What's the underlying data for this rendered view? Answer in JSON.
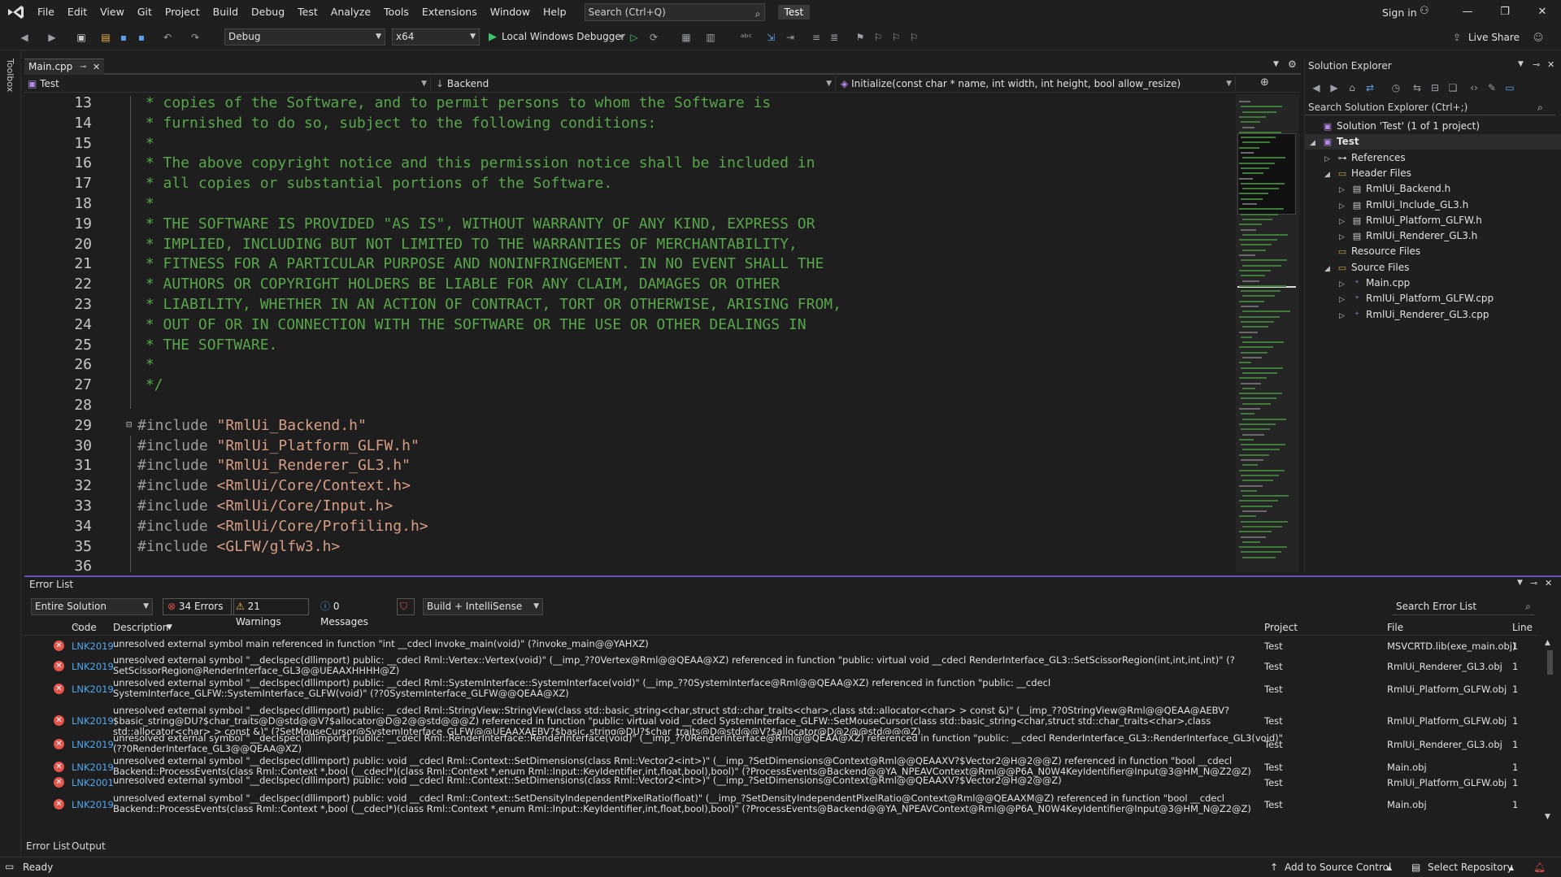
{
  "menubar": {
    "items": [
      "File",
      "Edit",
      "View",
      "Git",
      "Project",
      "Build",
      "Debug",
      "Test",
      "Analyze",
      "Tools",
      "Extensions",
      "Window",
      "Help"
    ],
    "search_placeholder": "Search (Ctrl+Q)",
    "project_badge": "Test",
    "sign_in": "Sign in"
  },
  "toolbar": {
    "config": "Debug",
    "platform": "x64",
    "debugger": "Local Windows Debugger",
    "live_share": "Live Share"
  },
  "toolbox_label": "Toolbox",
  "editor": {
    "tab_label": "Main.cpp",
    "nav_project": "Test",
    "nav_scope": "Backend",
    "nav_member": "Initialize(const char * name, int width, int height, bool allow_resize)",
    "lines": [
      {
        "n": "13",
        "type": "cmt",
        "text": " * copies of the Software, and to permit persons to whom the Software is"
      },
      {
        "n": "14",
        "type": "cmt",
        "text": " * furnished to do so, subject to the following conditions:"
      },
      {
        "n": "15",
        "type": "cmt",
        "text": " *"
      },
      {
        "n": "16",
        "type": "cmt",
        "text": " * The above copyright notice and this permission notice shall be included in"
      },
      {
        "n": "17",
        "type": "cmt",
        "text": " * all copies or substantial portions of the Software."
      },
      {
        "n": "18",
        "type": "cmt",
        "text": " *"
      },
      {
        "n": "19",
        "type": "cmt",
        "text": " * THE SOFTWARE IS PROVIDED \"AS IS\", WITHOUT WARRANTY OF ANY KIND, EXPRESS OR"
      },
      {
        "n": "20",
        "type": "cmt",
        "text": " * IMPLIED, INCLUDING BUT NOT LIMITED TO THE WARRANTIES OF MERCHANTABILITY,"
      },
      {
        "n": "21",
        "type": "cmt",
        "text": " * FITNESS FOR A PARTICULAR PURPOSE AND NONINFRINGEMENT. IN NO EVENT SHALL THE"
      },
      {
        "n": "22",
        "type": "cmt",
        "text": " * AUTHORS OR COPYRIGHT HOLDERS BE LIABLE FOR ANY CLAIM, DAMAGES OR OTHER"
      },
      {
        "n": "23",
        "type": "cmt",
        "text": " * LIABILITY, WHETHER IN AN ACTION OF CONTRACT, TORT OR OTHERWISE, ARISING FROM,"
      },
      {
        "n": "24",
        "type": "cmt",
        "text": " * OUT OF OR IN CONNECTION WITH THE SOFTWARE OR THE USE OR OTHER DEALINGS IN"
      },
      {
        "n": "25",
        "type": "cmt",
        "text": " * THE SOFTWARE."
      },
      {
        "n": "26",
        "type": "cmt",
        "text": " *"
      },
      {
        "n": "27",
        "type": "cmt",
        "text": " */"
      },
      {
        "n": "28",
        "type": "blank",
        "text": ""
      },
      {
        "n": "29",
        "type": "inc",
        "kw": "#include ",
        "text": "\"RmlUi_Backend.h\""
      },
      {
        "n": "30",
        "type": "inc",
        "kw": "#include ",
        "text": "\"RmlUi_Platform_GLFW.h\""
      },
      {
        "n": "31",
        "type": "inc",
        "kw": "#include ",
        "text": "\"RmlUi_Renderer_GL3.h\""
      },
      {
        "n": "32",
        "type": "inc",
        "kw": "#include ",
        "text": "<RmlUi/Core/Context.h>"
      },
      {
        "n": "33",
        "type": "inc",
        "kw": "#include ",
        "text": "<RmlUi/Core/Input.h>"
      },
      {
        "n": "34",
        "type": "inc",
        "kw": "#include ",
        "text": "<RmlUi/Core/Profiling.h>"
      },
      {
        "n": "35",
        "type": "inc",
        "kw": "#include ",
        "text": "<GLFW/glfw3.h>"
      },
      {
        "n": "36",
        "type": "blank",
        "text": ""
      }
    ]
  },
  "solution": {
    "title": "Solution Explorer",
    "search_placeholder": "Search Solution Explorer (Ctrl+;)",
    "items": [
      {
        "label": "Solution 'Test' (1 of 1 project)",
        "depth": 0,
        "twisty": "",
        "icon": "sol"
      },
      {
        "label": "Test",
        "depth": 0,
        "twisty": "open",
        "icon": "proj",
        "bold": true
      },
      {
        "label": "References",
        "depth": 1,
        "twisty": "closed",
        "icon": "ref"
      },
      {
        "label": "Header Files",
        "depth": 1,
        "twisty": "open",
        "icon": "folder"
      },
      {
        "label": "RmlUi_Backend.h",
        "depth": 2,
        "twisty": "closed",
        "icon": "h"
      },
      {
        "label": "RmlUi_Include_GL3.h",
        "depth": 2,
        "twisty": "closed",
        "icon": "h"
      },
      {
        "label": "RmlUi_Platform_GLFW.h",
        "depth": 2,
        "twisty": "closed",
        "icon": "h"
      },
      {
        "label": "RmlUi_Renderer_GL3.h",
        "depth": 2,
        "twisty": "closed",
        "icon": "h"
      },
      {
        "label": "Resource Files",
        "depth": 1,
        "twisty": "",
        "icon": "folder"
      },
      {
        "label": "Source Files",
        "depth": 1,
        "twisty": "open",
        "icon": "folder"
      },
      {
        "label": "Main.cpp",
        "depth": 2,
        "twisty": "closed",
        "icon": "cpp"
      },
      {
        "label": "RmlUi_Platform_GLFW.cpp",
        "depth": 2,
        "twisty": "closed",
        "icon": "cpp"
      },
      {
        "label": "RmlUi_Renderer_GL3.cpp",
        "depth": 2,
        "twisty": "closed",
        "icon": "cpp"
      }
    ]
  },
  "errorlist": {
    "title": "Error List",
    "scope": "Entire Solution",
    "errors_chip": "34 Errors",
    "warnings_chip": "21 Warnings",
    "messages_chip": "0 Messages",
    "build_filter": "Build + IntelliSense",
    "search_placeholder": "Search Error List",
    "columns": {
      "code": "Code",
      "description": "Description",
      "project": "Project",
      "file": "File",
      "line": "Line"
    },
    "rows": [
      {
        "code": "LNK2019",
        "desc": "unresolved external symbol main referenced in function \"int __cdecl invoke_main(void)\" (?invoke_main@@YAHXZ)",
        "project": "Test",
        "file": "MSVCRTD.lib(exe_main.obj)",
        "line": "1"
      },
      {
        "code": "LNK2019",
        "desc": "unresolved external symbol \"__declspec(dllimport) public: __cdecl Rml::Vertex::Vertex(void)\" (__imp_??0Vertex@Rml@@QEAA@XZ) referenced in function \"public: virtual void __cdecl RenderInterface_GL3::SetScissorRegion(int,int,int,int)\" (?SetScissorRegion@RenderInterface_GL3@@UEAAXHHHH@Z)",
        "project": "Test",
        "file": "RmlUi_Renderer_GL3.obj",
        "line": "1"
      },
      {
        "code": "LNK2019",
        "desc": "unresolved external symbol \"__declspec(dllimport) public: __cdecl Rml::SystemInterface::SystemInterface(void)\" (__imp_??0SystemInterface@Rml@@QEAA@XZ) referenced in function \"public: __cdecl SystemInterface_GLFW::SystemInterface_GLFW(void)\" (??0SystemInterface_GLFW@@QEAA@XZ)",
        "project": "Test",
        "file": "RmlUi_Platform_GLFW.obj",
        "line": "1"
      },
      {
        "code": "LNK2019",
        "desc": "unresolved external symbol \"__declspec(dllimport) public: __cdecl Rml::StringView::StringView(class std::basic_string<char,struct std::char_traits<char>,class std::allocator<char> > const &)\" (__imp_??0StringView@Rml@@QEAA@AEBV?$basic_string@DU?$char_traits@D@std@@V?$allocator@D@2@@std@@@Z) referenced in function \"public: virtual void __cdecl SystemInterface_GLFW::SetMouseCursor(class std::basic_string<char,struct std::char_traits<char>,class std::allocator<char> > const &)\" (?SetMouseCursor@SystemInterface_GLFW@@UEAAXAEBV?$basic_string@DU?$char_traits@D@std@@V?$allocator@D@2@@std@@@Z)",
        "project": "Test",
        "file": "RmlUi_Platform_GLFW.obj",
        "line": "1"
      },
      {
        "code": "LNK2019",
        "desc": "unresolved external symbol \"__declspec(dllimport) public: __cdecl Rml::RenderInterface::RenderInterface(void)\" (__imp_??0RenderInterface@Rml@@QEAA@XZ) referenced in function \"public: __cdecl RenderInterface_GL3::RenderInterface_GL3(void)\" (??0RenderInterface_GL3@@QEAA@XZ)",
        "project": "Test",
        "file": "RmlUi_Renderer_GL3.obj",
        "line": "1"
      },
      {
        "code": "LNK2019",
        "desc": "unresolved external symbol \"__declspec(dllimport) public: void __cdecl Rml::Context::SetDimensions(class Rml::Vector2<int>)\" (__imp_?SetDimensions@Context@Rml@@QEAAXV?$Vector2@H@2@@Z) referenced in function \"bool __cdecl Backend::ProcessEvents(class Rml::Context *,bool (__cdecl*)(class Rml::Context *,enum Rml::Input::KeyIdentifier,int,float,bool),bool)\" (?ProcessEvents@Backend@@YA_NPEAVContext@Rml@@P6A_N0W4KeyIdentifier@Input@3@HM_N@Z2@Z)",
        "project": "Test",
        "file": "Main.obj",
        "line": "1"
      },
      {
        "code": "LNK2001",
        "desc": "unresolved external symbol \"__declspec(dllimport) public: void __cdecl Rml::Context::SetDimensions(class Rml::Vector2<int>)\" (__imp_?SetDimensions@Context@Rml@@QEAAXV?$Vector2@H@2@@Z)",
        "project": "Test",
        "file": "RmlUi_Platform_GLFW.obj",
        "line": "1"
      },
      {
        "code": "LNK2019",
        "desc": "unresolved external symbol \"__declspec(dllimport) public: void __cdecl Rml::Context::SetDensityIndependentPixelRatio(float)\" (__imp_?SetDensityIndependentPixelRatio@Context@Rml@@QEAAXM@Z) referenced in function \"bool __cdecl Backend::ProcessEvents(class Rml::Context *,bool (__cdecl*)(class Rml::Context *,enum Rml::Input::KeyIdentifier,int,float,bool),bool)\" (?ProcessEvents@Backend@@YA_NPEAVContext@Rml@@P6A_N0W4KeyIdentifier@Input@3@HM_N@Z2@Z)",
        "project": "Test",
        "file": "Main.obj",
        "line": "1"
      }
    ]
  },
  "bottom_tabs": [
    "Error List",
    "Output"
  ],
  "statusbar": {
    "ready": "Ready",
    "add_source": "Add to Source Control",
    "select_repo": "Select Repository"
  }
}
